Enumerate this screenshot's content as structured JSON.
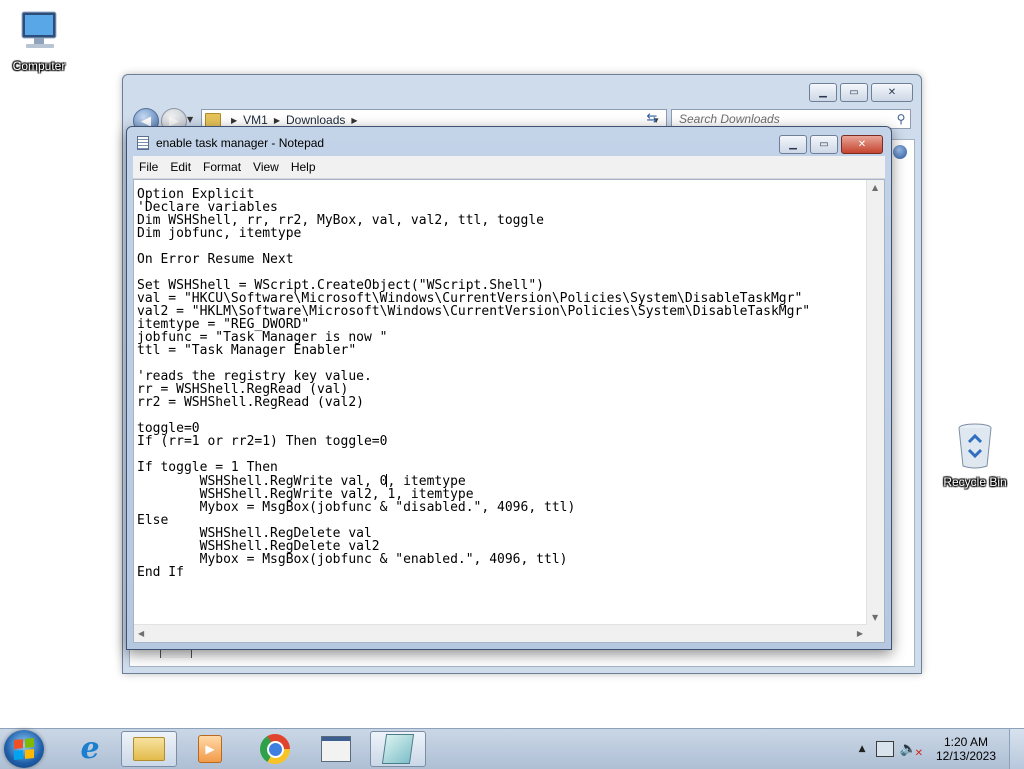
{
  "desktop": {
    "computer_label": "Computer",
    "recycle_label": "Recycle Bin"
  },
  "explorer": {
    "breadcrumb": [
      "VM1",
      "Downloads"
    ],
    "search_placeholder": "Search Downloads"
  },
  "notepad": {
    "title": "enable task manager - Notepad",
    "menu": [
      "File",
      "Edit",
      "Format",
      "View",
      "Help"
    ],
    "text_before_caret": "Option Explicit\n'Declare variables\nDim WSHShell, rr, rr2, MyBox, val, val2, ttl, toggle\nDim jobfunc, itemtype\n\nOn Error Resume Next\n\nSet WSHShell = WScript.CreateObject(\"WScript.Shell\")\nval = \"HKCU\\Software\\Microsoft\\Windows\\CurrentVersion\\Policies\\System\\DisableTaskMgr\"\nval2 = \"HKLM\\Software\\Microsoft\\Windows\\CurrentVersion\\Policies\\System\\DisableTaskMgr\"\nitemtype = \"REG_DWORD\"\njobfunc = \"Task Manager is now \"\nttl = \"Task Manager Enabler\"\n\n'reads the registry key value.\nrr = WSHShell.RegRead (val)\nrr2 = WSHShell.RegRead (val2)\n\ntoggle=0\nIf (rr=1 or rr2=1) Then toggle=0\n\nIf toggle = 1 Then\n        WSHShell.RegWrite val, 0",
    "text_after_caret": ", itemtype\n        WSHShell.RegWrite val2, 1, itemtype\n        Mybox = MsgBox(jobfunc & \"disabled.\", 4096, ttl)\nElse\n        WSHShell.RegDelete val\n        WSHShell.RegDelete val2\n        Mybox = MsgBox(jobfunc & \"enabled.\", 4096, ttl)\nEnd If"
  },
  "taskbar": {
    "apps": [
      "internet-explorer",
      "windows-explorer",
      "windows-media-player",
      "google-chrome",
      "application",
      "notepad"
    ],
    "active_app": "notepad",
    "clock_time": "1:20 AM",
    "clock_date": "12/13/2023"
  },
  "icons": {
    "volume_muted": true
  },
  "colors": {
    "close_button": "#c4442f",
    "title_bar": "#c3d3e8"
  }
}
